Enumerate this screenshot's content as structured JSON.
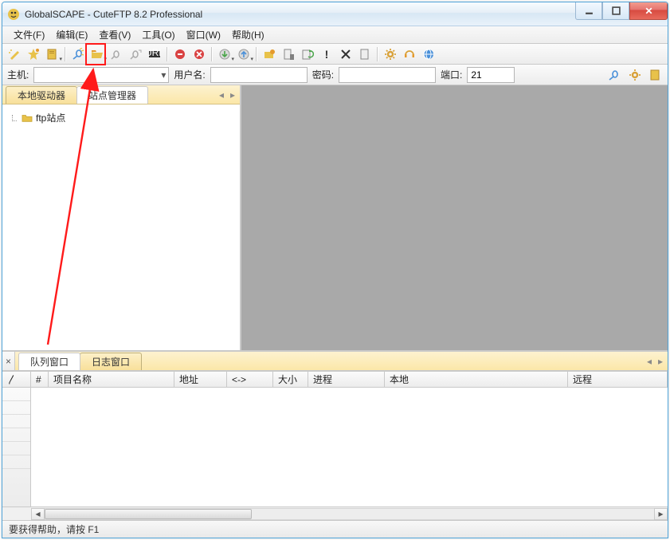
{
  "window": {
    "title": "GlobalSCAPE - CuteFTP 8.2 Professional"
  },
  "menu": {
    "file": "文件(F)",
    "edit": "编辑(E)",
    "view": "查看(V)",
    "tools": "工具(O)",
    "window": "窗口(W)",
    "help": "帮助(H)"
  },
  "connect": {
    "host_label": "主机:",
    "host_value": "",
    "user_label": "用户名:",
    "user_value": "",
    "pass_label": "密码:",
    "pass_value": "",
    "port_label": "端口:",
    "port_value": "21"
  },
  "left_tabs": {
    "local": "本地驱动器",
    "sites": "站点管理器"
  },
  "tree": {
    "root": "ftp站点"
  },
  "bottom_tabs": {
    "queue": "队列窗口",
    "log": "日志窗口"
  },
  "grid": {
    "cols": {
      "handle": "〳",
      "num": "#",
      "item": "项目名称",
      "addr": "地址",
      "dir": "<->",
      "size": "大小",
      "prog": "进程",
      "local": "本地",
      "remote": "远程"
    }
  },
  "status": {
    "text": "要获得帮助，请按 F1"
  }
}
